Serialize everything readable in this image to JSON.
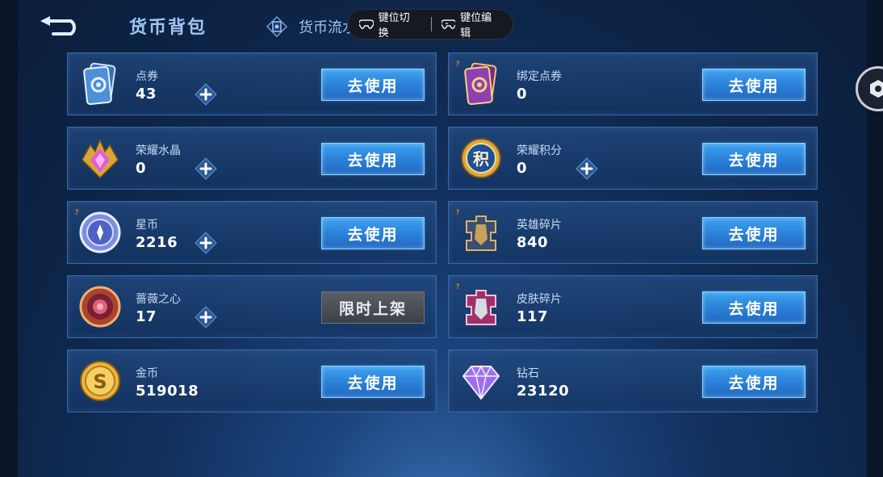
{
  "header": {
    "title": "货币背包",
    "flow_label": "货币流水"
  },
  "overlay": {
    "key_switch": "键位切换",
    "key_edit": "键位编辑"
  },
  "colors": {
    "use_button": "#2a7fd6",
    "use_button_border": "#8fd0ff",
    "limited_button": "#4a4e55",
    "card_bg": "#1c4479",
    "card_border": "#3a6aa6"
  },
  "currencies": [
    {
      "name": "点券",
      "amount": "43",
      "button": "去使用",
      "icon": "voucher-card-icon",
      "has_plus": true,
      "locked": false
    },
    {
      "name": "绑定点券",
      "amount": "0",
      "button": "去使用",
      "icon": "bound-voucher-card-icon",
      "has_plus": false,
      "locked": true
    },
    {
      "name": "荣耀水晶",
      "amount": "0",
      "button": "去使用",
      "icon": "glory-crystal-icon",
      "has_plus": true,
      "locked": false
    },
    {
      "name": "荣耀积分",
      "amount": "0",
      "button": "去使用",
      "icon": "glory-points-icon",
      "has_plus": true,
      "locked": false
    },
    {
      "name": "星币",
      "amount": "2216",
      "button": "去使用",
      "icon": "star-coin-icon",
      "has_plus": true,
      "locked": true
    },
    {
      "name": "英雄碎片",
      "amount": "840",
      "button": "去使用",
      "icon": "hero-shard-icon",
      "has_plus": false,
      "locked": true
    },
    {
      "name": "蔷薇之心",
      "amount": "17",
      "button": "限时上架",
      "icon": "rose-heart-icon",
      "has_plus": true,
      "locked": false
    },
    {
      "name": "皮肤碎片",
      "amount": "117",
      "button": "去使用",
      "icon": "skin-shard-icon",
      "has_plus": false,
      "locked": true
    },
    {
      "name": "金币",
      "amount": "519018",
      "button": "去使用",
      "icon": "gold-coin-icon",
      "has_plus": false,
      "locked": false
    },
    {
      "name": "钻石",
      "amount": "23120",
      "button": "去使用",
      "icon": "diamond-icon",
      "has_plus": false,
      "locked": false
    }
  ]
}
